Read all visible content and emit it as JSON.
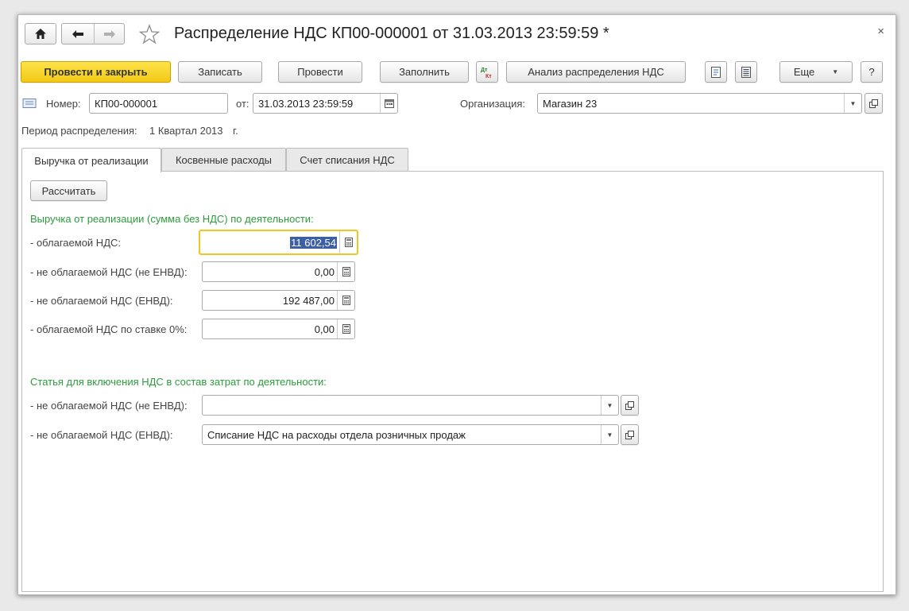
{
  "header": {
    "title": "Распределение НДС КП00-000001 от 31.03.2013 23:59:59 *",
    "close_glyph": "×"
  },
  "toolbar": {
    "post_and_close": "Провести и закрыть",
    "save": "Записать",
    "post": "Провести",
    "fill": "Заполнить",
    "analysis": "Анализ распределения НДС",
    "more": "Еще",
    "help": "?"
  },
  "form": {
    "number_label": "Номер:",
    "number_value": "КП00-000001",
    "date_label": "от:",
    "date_value": "31.03.2013 23:59:59",
    "org_label": "Организация:",
    "org_value": "Магазин 23",
    "period_label": "Период распределения:",
    "period_value": "1 Квартал 2013",
    "period_suffix": "г."
  },
  "tabs": [
    {
      "label": "Выручка от реализации",
      "active": true
    },
    {
      "label": "Косвенные расходы",
      "active": false
    },
    {
      "label": "Счет списания НДС",
      "active": false
    }
  ],
  "revenue": {
    "calculate_button": "Рассчитать",
    "group_title": "Выручка от реализации (сумма без НДС) по деятельности:",
    "rows": [
      {
        "label": "- облагаемой НДС:",
        "value": "11 602,54"
      },
      {
        "label": "- не облагаемой НДС (не ЕНВД):",
        "value": "0,00"
      },
      {
        "label": "- не облагаемой НДС (ЕНВД):",
        "value": "192 487,00"
      },
      {
        "label": "- облагаемой НДС по ставке 0%:",
        "value": "0,00"
      }
    ]
  },
  "expense_items": {
    "group_title": "Статья для включения НДС в состав затрат по деятельности:",
    "rows": [
      {
        "label": "- не облагаемой НДС (не ЕНВД):",
        "value": ""
      },
      {
        "label": "- не облагаемой НДС (ЕНВД):",
        "value": "Списание НДС на расходы отдела розничных продаж"
      }
    ]
  },
  "colors": {
    "primary_button": "#f5cf1e",
    "group_title": "#2c9b3c",
    "focus_border": "#f2c522",
    "selection": "#3b5ea6"
  },
  "icons": [
    "home-icon",
    "arrow-left-icon",
    "arrow-right-icon",
    "star-icon",
    "dt-kt-icon",
    "print-doc-icon",
    "report-icon",
    "document-icon",
    "calendar-icon",
    "calculator-icon",
    "open-icon"
  ]
}
